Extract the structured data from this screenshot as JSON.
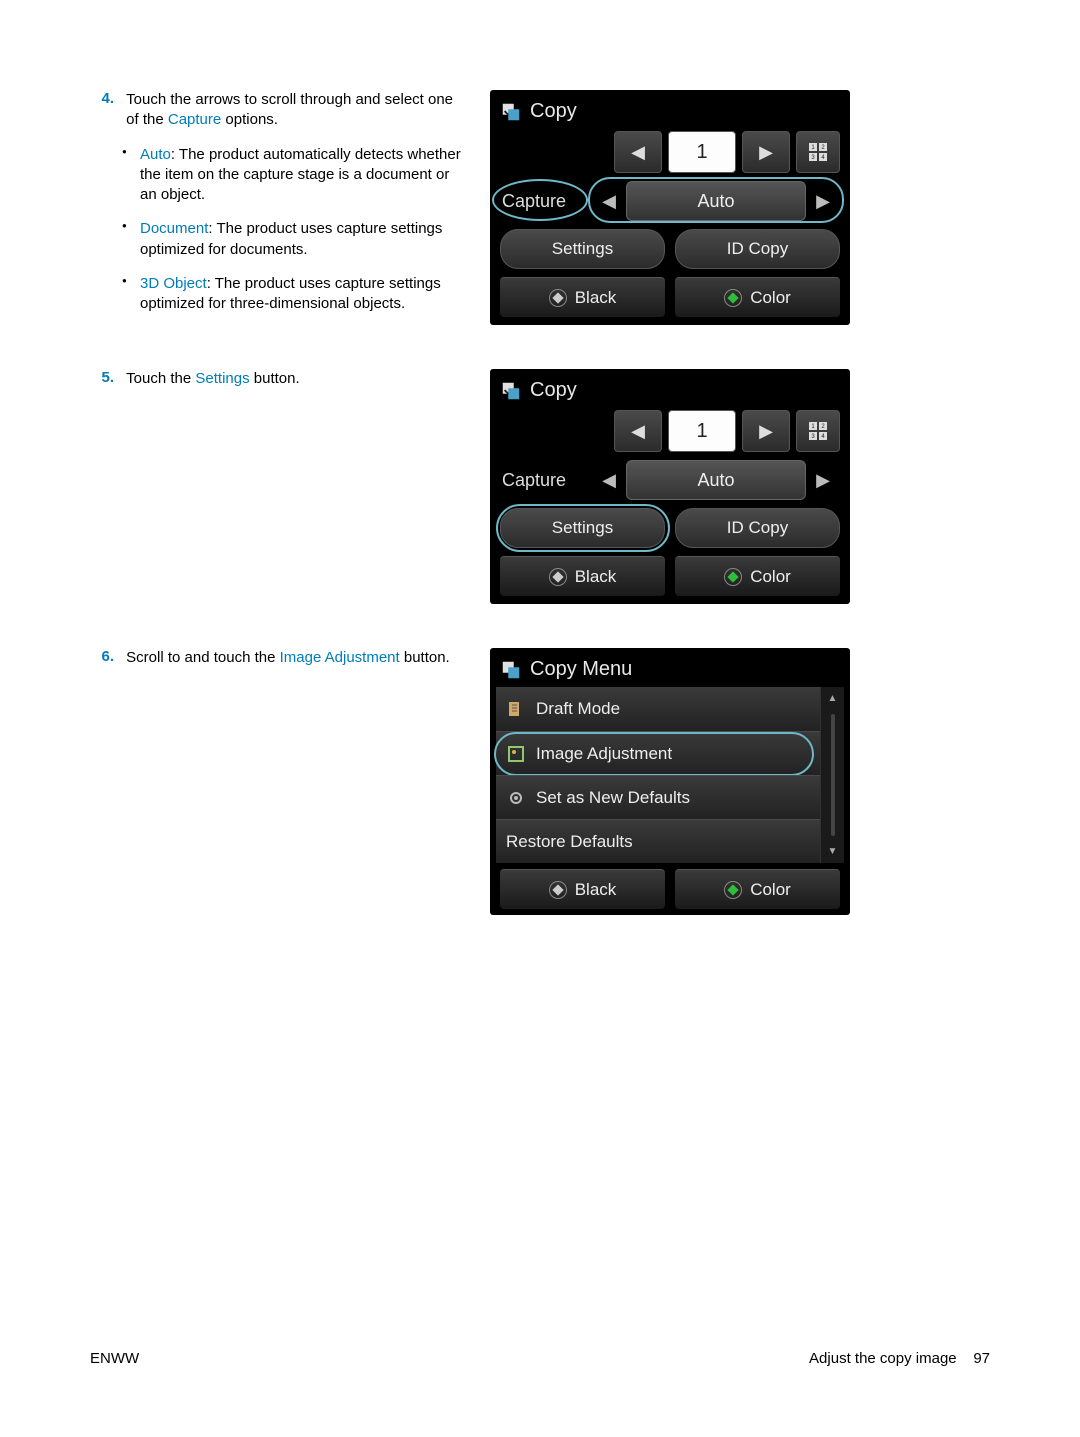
{
  "steps": {
    "s4": {
      "num": "4.",
      "text_a": "Touch the arrows to scroll through and select one of the ",
      "kw": "Capture",
      "text_b": " options.",
      "bullets": [
        {
          "kw": "Auto",
          "text": ": The product automatically detects whether the item on the capture stage is a document or an object."
        },
        {
          "kw": "Document",
          "text": ": The product uses capture settings optimized for documents."
        },
        {
          "kw": "3D Object",
          "text": ": The product uses capture settings optimized for three-dimensional objects."
        }
      ]
    },
    "s5": {
      "num": "5.",
      "text_a": "Touch the ",
      "kw": "Settings",
      "text_b": " button."
    },
    "s6": {
      "num": "6.",
      "text_a": "Scroll to and touch the ",
      "kw": "Image Adjustment",
      "text_b": " button."
    }
  },
  "panel_copy": {
    "title": "Copy",
    "count": "1",
    "capture_label": "Capture",
    "capture_value": "Auto",
    "settings": "Settings",
    "id_copy": "ID Copy",
    "black": "Black",
    "color": "Color"
  },
  "panel_menu": {
    "title": "Copy Menu",
    "items": [
      "Draft Mode",
      "Image Adjustment",
      "Set as New Defaults",
      "Restore Defaults"
    ],
    "black": "Black",
    "color": "Color"
  },
  "footer": {
    "left": "ENWW",
    "right_label": "Adjust the copy image",
    "page": "97"
  }
}
